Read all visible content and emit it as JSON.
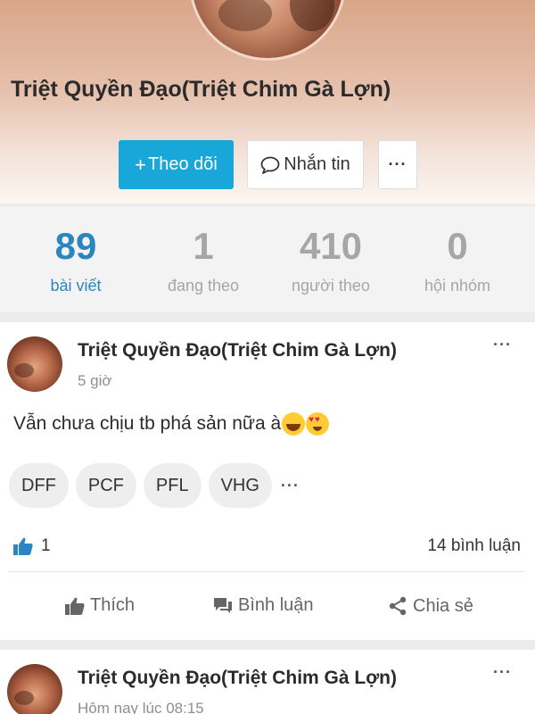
{
  "profile": {
    "name": "Triệt Quyền Đạo(Triệt Chim Gà Lợn)",
    "follow_button": "Theo dõi",
    "message_button": "Nhắn tin",
    "more_button": "···"
  },
  "stats": [
    {
      "value": "89",
      "label": "bài viết"
    },
    {
      "value": "1",
      "label": "đang theo"
    },
    {
      "value": "410",
      "label": "người theo"
    },
    {
      "value": "0",
      "label": "hội nhóm"
    }
  ],
  "posts": [
    {
      "author": "Triệt Quyền Đạo(Triệt Chim Gà Lợn)",
      "time": "5 giờ",
      "text": "Vẫn chưa chịu tb phá sản nữa à",
      "tags": [
        "DFF",
        "PCF",
        "PFL",
        "VHG"
      ],
      "tags_more": "···",
      "likes": "1",
      "comments": "14 bình luận",
      "menu": "···"
    },
    {
      "author": "Triệt Quyền Đạo(Triệt Chim Gà Lợn)",
      "time": "Hôm nay lúc 08:15",
      "menu": "···"
    }
  ],
  "actions": {
    "like": "Thích",
    "comment": "Bình luận",
    "share": "Chia sẻ"
  },
  "colors": {
    "accent": "#19a6d9",
    "active_stat": "#2a85c1",
    "muted": "#a6a6a6"
  },
  "icons": {
    "more": "more-icon",
    "message": "speech-bubble-icon",
    "like": "thumbs-up-icon",
    "comment": "comment-icon",
    "share": "share-icon"
  }
}
